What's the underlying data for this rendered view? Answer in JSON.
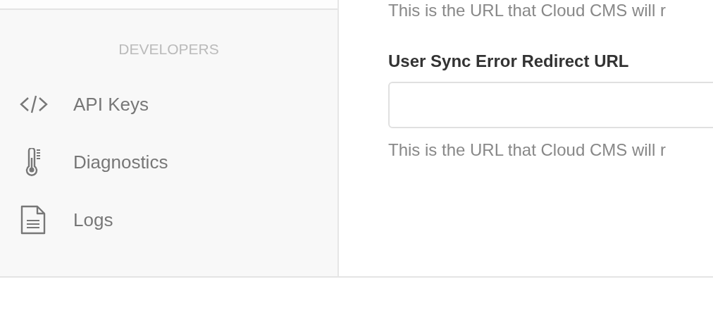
{
  "main": {
    "top_help_text": "This is the URL that Cloud CMS will r",
    "field_label": "User Sync Error Redirect URL",
    "help_text": "This is the URL that Cloud CMS will r"
  },
  "sidebar": {
    "section_title": "DEVELOPERS",
    "items": [
      {
        "label": "API Keys",
        "kind": "code"
      },
      {
        "label": "Diagnostics",
        "kind": "thermometer"
      },
      {
        "label": "Logs",
        "kind": "document"
      }
    ]
  }
}
